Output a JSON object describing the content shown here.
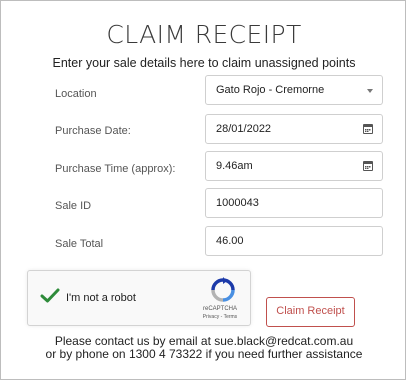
{
  "header": {
    "title": "CLAIM RECEIPT",
    "subtitle": "Enter your sale details here to claim unassigned points"
  },
  "form": {
    "fields": [
      {
        "label": "Location",
        "value": "Gato Rojo - Cremorne",
        "control": "select",
        "icon": "chevron-down-icon"
      },
      {
        "label": "Purchase Date:",
        "value": "28/01/2022",
        "control": "date",
        "icon": "calendar-icon"
      },
      {
        "label": "Purchase Time (approx):",
        "value": "9.46am",
        "control": "time",
        "icon": "calendar-icon"
      },
      {
        "label": "Sale ID",
        "value": "1000043",
        "control": "text"
      },
      {
        "label": "Sale Total",
        "value": "46.00",
        "control": "text"
      }
    ]
  },
  "recaptcha": {
    "label": "I'm not a robot",
    "checked": true,
    "brand": "reCAPTCHA",
    "privacy": "Privacy",
    "terms": "Terms",
    "check_color": "#2e8b3a"
  },
  "actions": {
    "submit_label": "Claim Receipt",
    "accent_color": "#c0504d"
  },
  "footer": {
    "line1": "Please contact us by email at sue.black@redcat.com.au",
    "line2": "or by phone on 1300 4 73322 if you need further assistance"
  }
}
